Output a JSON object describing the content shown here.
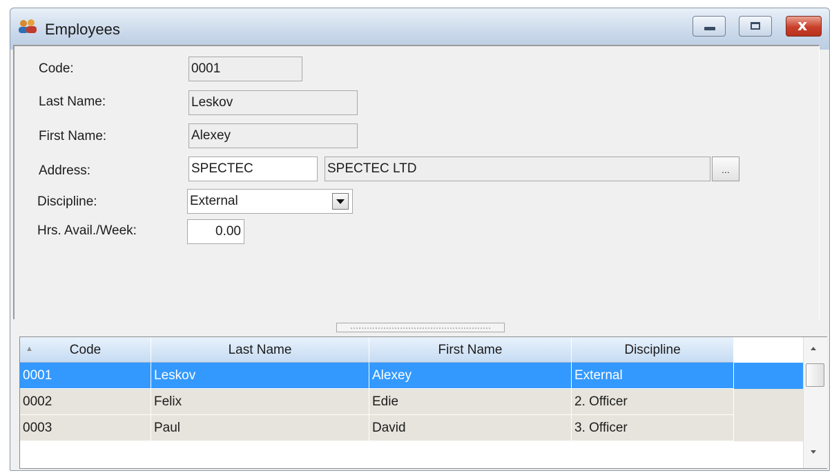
{
  "window": {
    "title": "Employees",
    "icon": "users-icon",
    "controls": {
      "minimize": "minimize-icon",
      "maximize": "maximize-icon",
      "close_glyph": "x"
    }
  },
  "form": {
    "code": {
      "label": "Code:",
      "value": "0001"
    },
    "last_name": {
      "label": "Last Name:",
      "value": "Leskov"
    },
    "first_name": {
      "label": "First Name:",
      "value": "Alexey"
    },
    "address": {
      "label": "Address:",
      "code": "SPECTEC",
      "name": "SPECTEC LTD",
      "lookup_label": "..."
    },
    "discipline": {
      "label": "Discipline:",
      "value": "External"
    },
    "hours": {
      "label": "Hrs. Avail./Week:",
      "value": "0.00"
    }
  },
  "grid": {
    "columns": [
      "Code",
      "Last Name",
      "First Name",
      "Discipline"
    ],
    "sorted_column": "Code",
    "rows": [
      {
        "code": "0001",
        "last_name": "Leskov",
        "first_name": "Alexey",
        "discipline": "External",
        "selected": true
      },
      {
        "code": "0002",
        "last_name": "Felix",
        "first_name": "Edie",
        "discipline": "2. Officer",
        "selected": false
      },
      {
        "code": "0003",
        "last_name": "Paul",
        "first_name": "David",
        "discipline": "3. Officer",
        "selected": false
      }
    ]
  },
  "colors": {
    "selection": "#3399ff",
    "row_background": "#e6e4dc",
    "header_gradient_top": "#e8f2fc",
    "header_gradient_bottom": "#c6dbf2",
    "close_button": "#c9402a"
  }
}
